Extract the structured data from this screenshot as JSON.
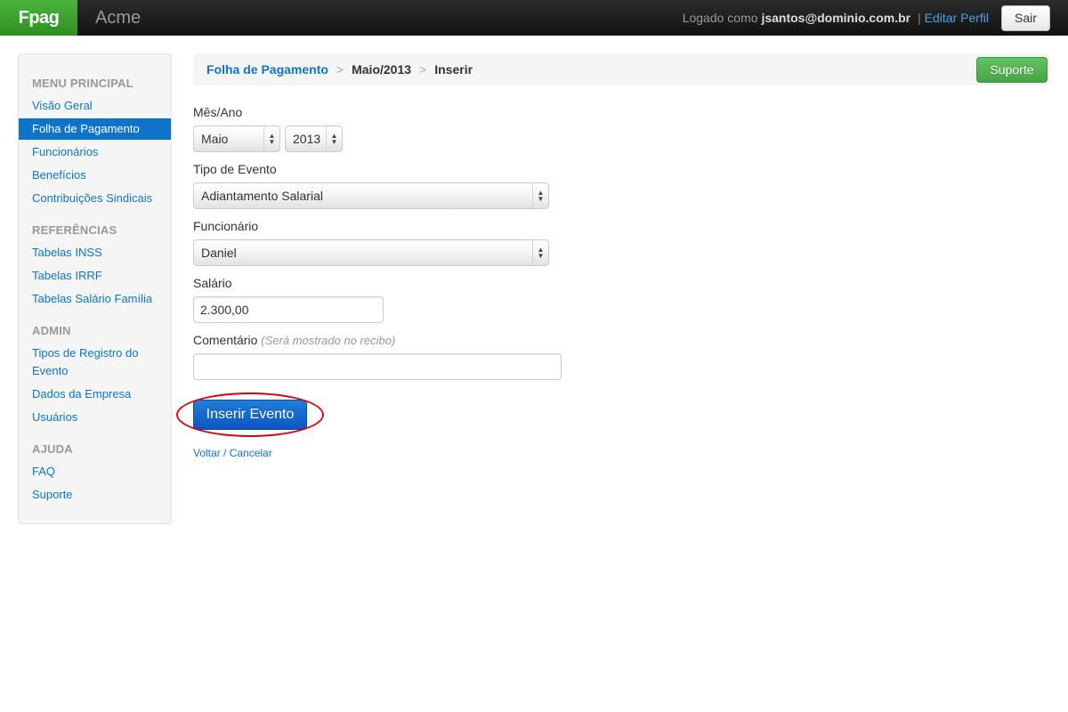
{
  "header": {
    "brand": "Fpag",
    "company": "Acme",
    "logged_as_prefix": "Logado como",
    "username": "jsantos@dominio.com.br",
    "separator": "|",
    "edit_profile": "Editar Perfil",
    "logout": "Sair"
  },
  "sidebar": {
    "sections": [
      {
        "header": "MENU PRINCIPAL",
        "items": [
          "Visão Geral",
          "Folha de Pagamento",
          "Funcionários",
          "Benefícios",
          "Contribuições Sindicais"
        ]
      },
      {
        "header": "REFERÊNCIAS",
        "items": [
          "Tabelas INSS",
          "Tabelas IRRF",
          "Tabelas Salário Família"
        ]
      },
      {
        "header": "ADMIN",
        "items": [
          "Tipos de Registro do",
          "Evento",
          "Dados da Empresa",
          "Usuários"
        ]
      },
      {
        "header": "AJUDA",
        "items": [
          "FAQ",
          "Suporte"
        ]
      }
    ],
    "active_item": "Folha de Pagamento"
  },
  "breadcrumb": {
    "items": [
      "Folha de Pagamento",
      "Maio/2013",
      "Inserir"
    ],
    "separator": ">"
  },
  "support_button": "Suporte",
  "form": {
    "month_year_label": "Mês/Ano",
    "month_value": "Maio",
    "year_value": "2013",
    "event_type_label": "Tipo de Evento",
    "event_type_value": "Adiantamento Salarial",
    "employee_label": "Funcionário",
    "employee_value": "Daniel",
    "salary_label": "Salário",
    "salary_value": "2.300,00",
    "comment_label": "Comentário",
    "comment_hint": "(Será mostrado no recibo)",
    "comment_value": "",
    "submit_label": "Inserir Evento",
    "cancel_label": "Voltar / Cancelar"
  },
  "colors": {
    "brand_green": "#2f8f23",
    "link_blue": "#0f74c8",
    "primary_blue": "#0c55c2",
    "success_green": "#46a246",
    "highlight_red": "#d8000c"
  }
}
